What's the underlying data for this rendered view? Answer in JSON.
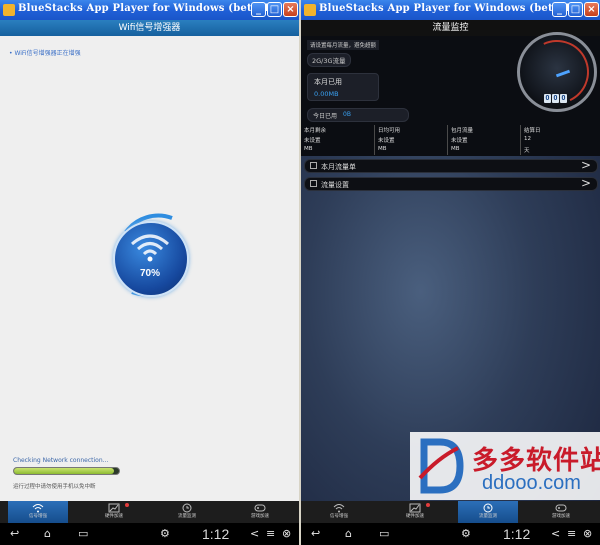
{
  "window_left": {
    "title": "BlueStacks App Player for Windows (beta-1)",
    "header": "Wifi信号增强器",
    "status": "• WiFi信号增强器正在增强",
    "progress_percent": "70%",
    "checking_text": "Checking Network connection...",
    "progress_fraction": 0.95,
    "hint": "运行过程中请勿使用手机以免中断",
    "tabs": [
      {
        "label": "信号增强",
        "icon": "wifi-icon",
        "active": true
      },
      {
        "label": "硬件加速",
        "icon": "chart-icon",
        "badge": true
      },
      {
        "label": "流量监测",
        "icon": "clock-icon"
      },
      {
        "label": "游戏加速",
        "icon": "gamepad-icon"
      }
    ],
    "clock": "1:12"
  },
  "window_right": {
    "title": "BlueStacks App Player for Windows (beta-1)",
    "header": "流量监控",
    "tip": "请设置每月流量，避免超额",
    "mode": "2G/3G流量",
    "month_used_label": "本月已用",
    "month_used_value": "0.00MB",
    "today_label": "今日已用",
    "today_value": "0B",
    "speed_digits": [
      "0",
      "0",
      "0"
    ],
    "stats": [
      {
        "header": "本月剩余",
        "value": "未设置",
        "unit": "MB"
      },
      {
        "header": "日均可用",
        "value": "未设置",
        "unit": "MB"
      },
      {
        "header": "包月流量",
        "value": "未设置",
        "unit": "MB"
      },
      {
        "header": "结算日",
        "value": "12",
        "unit": "天"
      }
    ],
    "rows": [
      {
        "label": "本月流量单",
        "arrow": ">"
      },
      {
        "label": "流量设置",
        "arrow": ">"
      }
    ],
    "tabs": [
      {
        "label": "信号增强",
        "icon": "wifi-icon"
      },
      {
        "label": "硬件加速",
        "icon": "chart-icon",
        "badge": true
      },
      {
        "label": "流量监测",
        "icon": "clock-icon",
        "active": true
      },
      {
        "label": "游戏加速",
        "icon": "gamepad-icon"
      }
    ],
    "clock": "1:12"
  },
  "watermark": {
    "cn": "多多软件站",
    "en": "ddooo.com"
  },
  "colors": {
    "titlebar": "#1f5fd6",
    "accent": "#39a0f0",
    "progress": "#a9d04a",
    "watermark_red": "#c91b2a",
    "watermark_blue": "#2b6fc0"
  }
}
